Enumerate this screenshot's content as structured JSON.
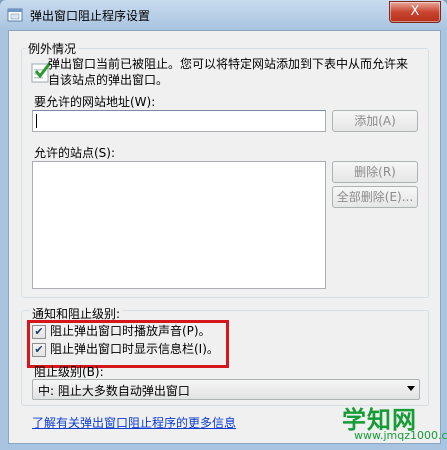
{
  "window": {
    "title": "弹出窗口阻止程序设置",
    "close_label": "X"
  },
  "exceptions": {
    "group_label": "例外情况",
    "description": "弹出窗口当前已被阻止。您可以将特定网站添加到下表中从而允许来自该站点的弹出窗口。",
    "address_label": "要允许的网站地址(W):",
    "address_value": "",
    "add_button": "添加(A)",
    "allowed_label": "允许的站点(S):",
    "allowed_sites": [],
    "remove_button": "删除(R)",
    "remove_all_button": "全部删除(E)..."
  },
  "notification": {
    "group_label": "通知和阻止级别:",
    "play_sound_label": "阻止弹出窗口时播放声音(P)。",
    "play_sound_checked": true,
    "show_infobar_label": "阻止弹出窗口时显示信息栏(I)。",
    "show_infobar_checked": true,
    "level_label": "阻止级别(B):",
    "level_value": "中: 阻止大多数自动弹出窗口"
  },
  "footer": {
    "learn_more_link": "了解有关弹出窗口阻止程序的更多信息"
  },
  "watermark": {
    "main": "学知网",
    "sub": "www.jmqz1000.com"
  },
  "colors": {
    "highlight_border": "#d5161b",
    "link": "#0c3bd1",
    "watermark": "#169c37"
  }
}
